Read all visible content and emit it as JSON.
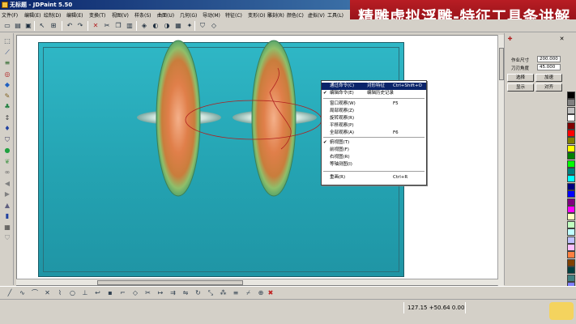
{
  "window": {
    "title": "无标题 - JDPaint 5.50"
  },
  "banner": {
    "text": "精雕虚拟浮雕-特征工具条讲解",
    "bg": "#a8161d"
  },
  "menu": [
    "文件(F)",
    "编辑(E)",
    "绘制(D)",
    "编辑(E)",
    "变换(T)",
    "视图(V)",
    "样条(S)",
    "曲面(U)",
    "几何(G)",
    "导动(M)",
    "特征(C)",
    "变形(O)",
    "雕刻(R)",
    "颜色(C)",
    "虚拟(V)",
    "工具(L)"
  ],
  "toolbar_icons": [
    "new-file-icon",
    "open-folder-icon",
    "save-disk-icon",
    "select-arrow-icon",
    "zoom-window-icon",
    "undo-icon",
    "redo-icon",
    "delete-icon",
    "cut-icon",
    "copy-icon",
    "paste-icon",
    "view-3d-icon",
    "render-icon",
    "shade-icon",
    "texture-icon",
    "light-icon",
    "shield-icon",
    "shield-outline-icon"
  ],
  "left_tools": [
    "rect-select-icon",
    "wand-icon",
    "layers-icon",
    "circle-target-icon",
    "diamond-icon",
    "brush-icon",
    "tree-icon",
    "arrows-vertical-icon",
    "balloon-icon",
    "shield-icon",
    "drop-icon",
    "leaf-icon",
    "chain-icon",
    "left-arrow-icon",
    "right-arrow-icon",
    "stamp-icon",
    "box-icon",
    "grid-icon",
    "shield-gray-icon"
  ],
  "context_menu": {
    "items": [
      {
        "label": "通过命令(C)",
        "hint": "对形特征",
        "shortcut": "Ctrl+Shift+O",
        "highlighted": true,
        "checked": false
      },
      {
        "label": "编辑命令(E)",
        "hint": "编辑历史记录",
        "shortcut": "",
        "highlighted": false,
        "checked": true
      },
      {
        "label": "窗口观察(W)",
        "hint": "",
        "shortcut": "F5",
        "highlighted": false,
        "checked": false
      },
      {
        "label": "局部观察(Z)",
        "hint": "",
        "shortcut": "",
        "highlighted": false,
        "checked": false
      },
      {
        "label": "旋转观察(R)",
        "hint": "",
        "shortcut": "",
        "highlighted": false,
        "checked": false
      },
      {
        "label": "平移观察(P)",
        "hint": "",
        "shortcut": "",
        "highlighted": false,
        "checked": false
      },
      {
        "label": "全部观察(A)",
        "hint": "",
        "shortcut": "F6",
        "highlighted": false,
        "checked": false
      },
      {
        "label": "俯视图(T)",
        "hint": "",
        "shortcut": "",
        "highlighted": false,
        "checked": true
      },
      {
        "label": "前视图(F)",
        "hint": "",
        "shortcut": "",
        "highlighted": false,
        "checked": false
      },
      {
        "label": "右视图(R)",
        "hint": "",
        "shortcut": "",
        "highlighted": false,
        "checked": false
      },
      {
        "label": "等轴测图(I)",
        "hint": "",
        "shortcut": "",
        "highlighted": false,
        "checked": false
      },
      {
        "label": "重画(R)",
        "hint": "",
        "shortcut": "Ctrl+R",
        "highlighted": false,
        "checked": false
      }
    ]
  },
  "right_panel": {
    "brush_diameter_label": "作业尺寸",
    "brush_diameter_value": "200.000",
    "depth_label": "刀刃角度",
    "depth_value": "45.000",
    "buttons": [
      "选择",
      "加速",
      "显示",
      "对齐"
    ]
  },
  "palette": [
    "#000000",
    "#808080",
    "#c0c0c0",
    "#ffffff",
    "#800000",
    "#ff0000",
    "#808000",
    "#ffff00",
    "#008000",
    "#00ff00",
    "#008080",
    "#00ffff",
    "#000080",
    "#0000ff",
    "#800080",
    "#ff00ff",
    "#ffffc0",
    "#c0ffc0",
    "#c0ffff",
    "#c0c0ff",
    "#ffc0ff",
    "#ff8040",
    "#804000",
    "#004040",
    "#408080",
    "#8080ff",
    "#ff80c0",
    "#c08000",
    "#80ff00",
    "#00c080",
    "#0080c0",
    "#4000c0"
  ],
  "bottom_tools": [
    "line-icon",
    "curve-icon",
    "arc-icon",
    "cross-icon",
    "polyline-icon",
    "circle-icon",
    "perpendicular-icon",
    "bend-icon",
    "point-icon",
    "fillet-icon",
    "chamfer-icon",
    "trim-icon",
    "extend-icon",
    "offset-icon",
    "mirror-icon",
    "rotate-icon",
    "scale-icon",
    "array-icon",
    "align-icon",
    "break-icon",
    "join-icon",
    "delete-red-icon"
  ],
  "status": {
    "coords": "127.15 +50.64 0.00"
  }
}
